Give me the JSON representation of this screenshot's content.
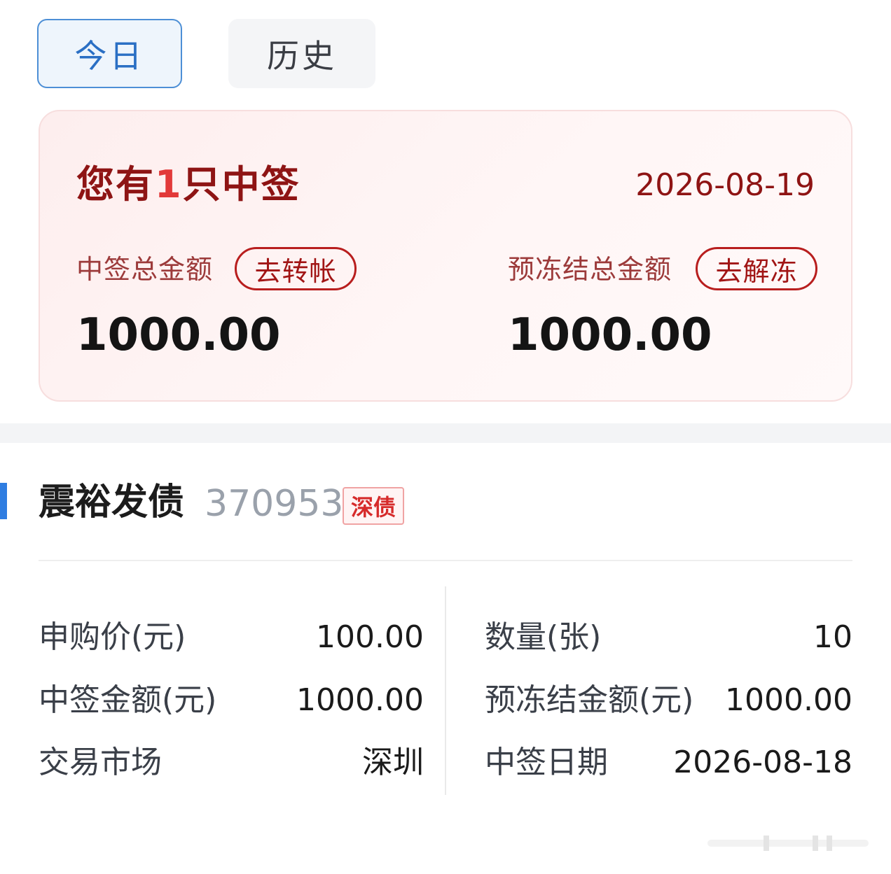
{
  "tabs": [
    {
      "label": "今日",
      "active": true
    },
    {
      "label": "历史",
      "active": false
    }
  ],
  "summary": {
    "title_prefix": "您有",
    "count": "1",
    "title_suffix": "只中签",
    "date": "2026-08-19",
    "left": {
      "label": "中签总金额",
      "action": "去转帐",
      "amount": "1000.00"
    },
    "right": {
      "label": "预冻结总金额",
      "action": "去解冻",
      "amount": "1000.00"
    }
  },
  "bond": {
    "name": "震裕发债",
    "code": "370953",
    "market_tag": "深债",
    "details": [
      {
        "label": "申购价(元)",
        "value": "100.00"
      },
      {
        "label": "数量(张)",
        "value": "10"
      },
      {
        "label": "中签金额(元)",
        "value": "1000.00"
      },
      {
        "label": "预冻结金额(元)",
        "value": "1000.00"
      },
      {
        "label": "交易市场",
        "value": "深圳"
      },
      {
        "label": "中签日期",
        "value": "2026-08-18"
      }
    ]
  },
  "colors": {
    "accent_blue": "#2f7de1",
    "title_red": "#8e1414",
    "highlight_red": "#e23a3a",
    "tag_red": "#d62b2b"
  }
}
